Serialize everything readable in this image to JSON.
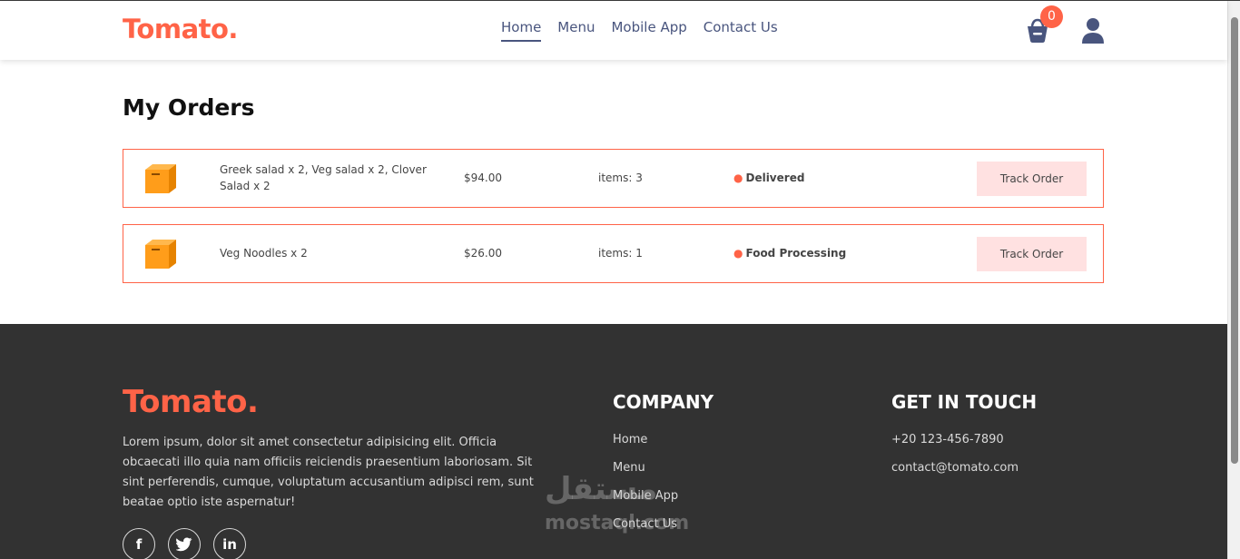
{
  "brand": {
    "logo": "Tomato.",
    "accent": "#ff6347"
  },
  "nav": {
    "links": [
      "Home",
      "Menu",
      "Mobile App",
      "Contact Us"
    ],
    "active": "Home",
    "cart_count": "0",
    "icons": [
      "basket-icon",
      "user-icon"
    ]
  },
  "page": {
    "title": "My Orders"
  },
  "orders": [
    {
      "items": "Greek salad x 2, Veg salad x 2, Clover Salad x 2",
      "amount": "$94.00",
      "count": "items: 3",
      "status": "Delivered",
      "button": "Track Order"
    },
    {
      "items": "Veg Noodles x 2",
      "amount": "$26.00",
      "count": "items: 1",
      "status": "Food Processing",
      "button": "Track Order"
    }
  ],
  "footer": {
    "logo": "Tomato.",
    "description": "Lorem ipsum, dolor sit amet consectetur adipisicing elit. Officia obcaecati illo quia nam officiis reiciendis praesentium laboriosam. Sit sint perferendis, cumque, voluptatum accusantium adipisci rem, sunt beatae optio iste aspernatur!",
    "social_icons": [
      "facebook-icon",
      "twitter-icon",
      "linkedin-icon"
    ],
    "company": {
      "title": "COMPANY",
      "links": [
        "Home",
        "Menu",
        "Mobile App",
        "Contact Us"
      ]
    },
    "contact": {
      "title": "GET IN TOUCH",
      "phone": "+20 123-456-7890",
      "email": "contact@tomato.com"
    }
  },
  "watermark": {
    "arabic": "مستقل",
    "latin": "mostaql.com"
  }
}
